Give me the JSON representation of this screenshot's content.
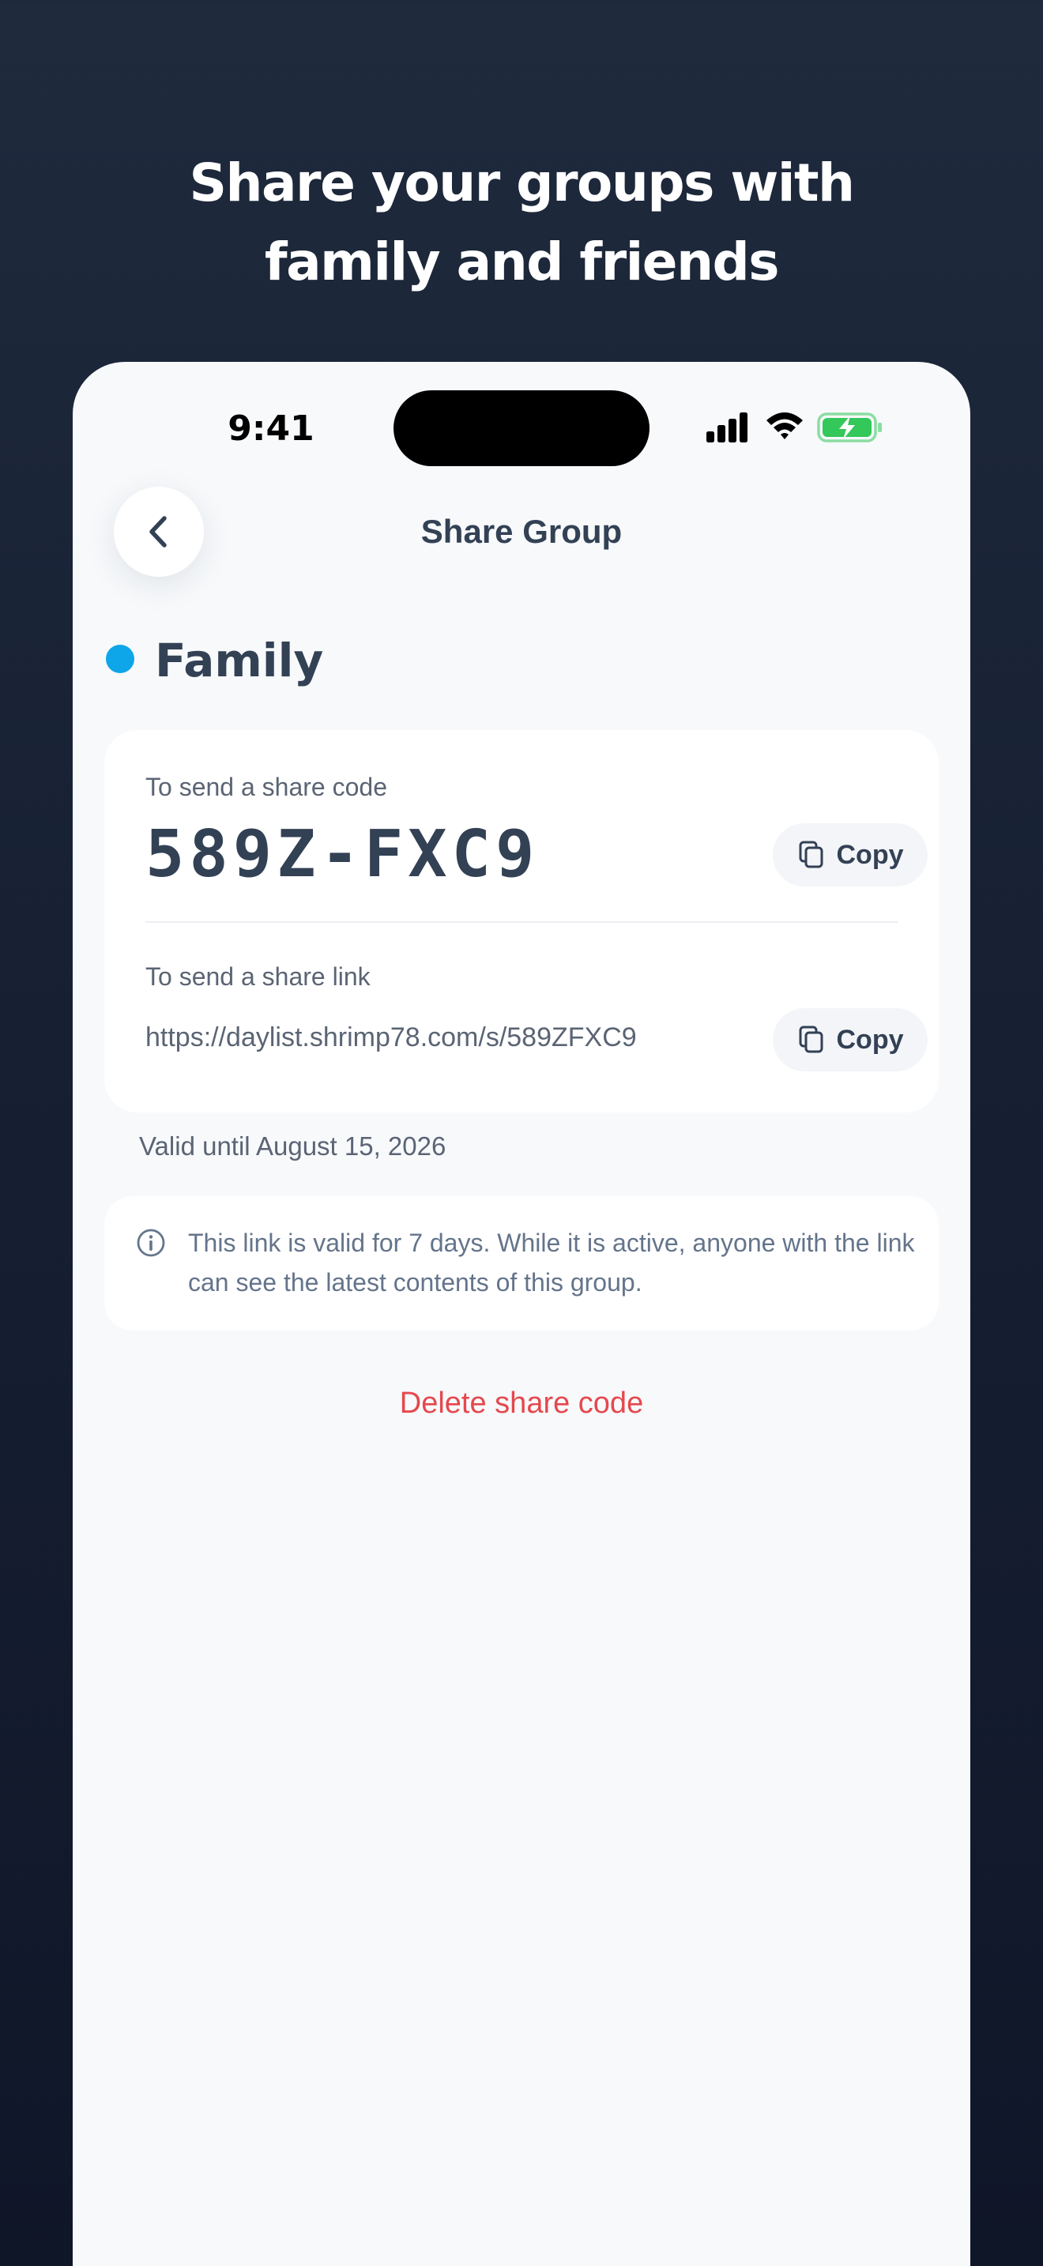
{
  "promo": {
    "headline_line1": "Share your groups with",
    "headline_line2": "family and friends"
  },
  "status_bar": {
    "time": "9:41",
    "icons": [
      "cellular-signal-icon",
      "wifi-icon",
      "battery-charging-icon"
    ],
    "battery_color": "#34c759"
  },
  "nav": {
    "back_icon": "chevron-left-icon",
    "title": "Share Group"
  },
  "group": {
    "name": "Family",
    "color": "#0ea5e9"
  },
  "share_code": {
    "label": "To send a share code",
    "code": "589Z-FXC9",
    "copy_label": "Copy"
  },
  "share_link": {
    "label": "To send a share link",
    "url": "https://daylist.shrimp78.com/s/589ZFXC9",
    "copy_label": "Copy"
  },
  "validity": {
    "text": "Valid until August 15, 2026"
  },
  "info": {
    "icon": "info-circle-icon",
    "text": "This link is valid for 7 days. While it is active, anyone with the link can see the latest contents of this group."
  },
  "actions": {
    "delete_label": "Delete share code",
    "delete_color": "#e5484d"
  }
}
